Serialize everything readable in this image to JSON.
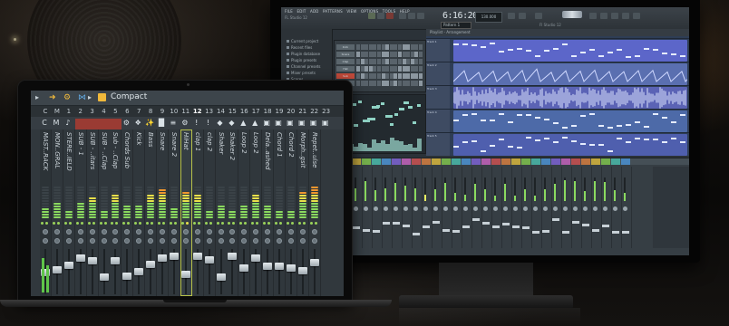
{
  "monitor": {
    "menu": [
      "FILE",
      "EDIT",
      "ADD",
      "PATTERNS",
      "VIEW",
      "OPTIONS",
      "TOOLS",
      "HELP"
    ],
    "title": "FL Studio 12",
    "tempo": "6:16:20",
    "lcd": "130.000",
    "pattern": "Pattern 1",
    "hint": "Fl Studio 12",
    "browser": [
      "Current project",
      "Recent files",
      "Plugin database",
      "Plugin presets",
      "Channel presets",
      "Mixer presets",
      "Scores"
    ],
    "rack_rows": [
      "Kick",
      "Snare",
      "Clap",
      "Hat",
      "Sub",
      "Bass"
    ],
    "playlist_header": "Playlist - Arrangement",
    "tracks": [
      "Track 1",
      "Track 2",
      "Track 3",
      "Track 4",
      "Track 5"
    ]
  },
  "laptop": {
    "compact_label": "Compact",
    "numbers": [
      "C",
      "M",
      "1",
      "2",
      "3",
      "4",
      "5",
      "6",
      "7",
      "8",
      "9",
      "10",
      "11",
      "12",
      "13",
      "14",
      "15",
      "16",
      "17",
      "18",
      "19",
      "20",
      "21",
      "22",
      "23"
    ],
    "strips": [
      "MAST..RACK",
      "MON..GRAL",
      "STERE..IELD",
      "SUB - 1",
      "SUB - ..itars",
      "SUB - ..Clap",
      "Sub - ..Clap",
      "Chords Sub",
      "Kick",
      "Bass",
      "Snare",
      "Snare 2",
      "HiHat",
      "clap 1",
      "clap 2",
      "Shaker",
      "Shaker 2",
      "Loop 2",
      "Loop 2",
      "Dela..ashed",
      "Chord 1",
      "Chord 2",
      "Morph..gsit",
      "Repet..ulse"
    ],
    "selected_strip": "12"
  },
  "colors": {
    "accent": "#b8c24a",
    "meter_green": "#8ad95f",
    "meter_yellow": "#e8e04a",
    "meter_orange": "#f0972f",
    "compact_icon": "#f0b93b"
  }
}
